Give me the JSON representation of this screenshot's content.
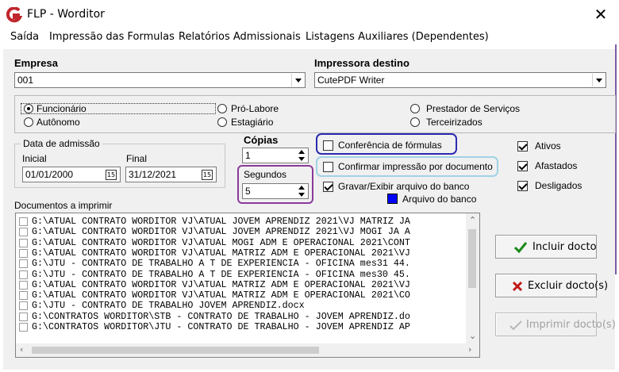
{
  "window": {
    "title": "FLP - Worditor",
    "close_glyph": "✕",
    "logo_color": "#c0272d"
  },
  "menu": [
    "Saída",
    "Impressão das Formulas",
    "Relatórios Admissionais",
    "Listagens Auxiliares (Dependentes)"
  ],
  "empresa": {
    "label": "Empresa",
    "value": "001"
  },
  "impressora": {
    "label": "Impressora destino",
    "value": "CutePDF Writer"
  },
  "tipo": {
    "options": [
      "Funcionário",
      "Pró-Labore",
      "Prestador de Serviços",
      "Autônomo",
      "Estagiário",
      "Terceirizados"
    ],
    "selected": "Funcionário"
  },
  "admissao": {
    "label": "Data de admissão",
    "inicial_label": "Inicial",
    "inicial": "01/01/2000",
    "final_label": "Final",
    "final": "31/12/2021",
    "calendar_glyph": "15"
  },
  "copias": {
    "label": "Cópias",
    "value": "1"
  },
  "segundos": {
    "label": "Segundos",
    "value": "5"
  },
  "options": {
    "conferencia": {
      "label": "Conferência de fórmulas",
      "checked": false,
      "highlight": "#2b2bb0"
    },
    "confirmar": {
      "label": "Confirmar impressão por documento",
      "checked": false,
      "highlight": "#9fd3e6"
    },
    "gravar": {
      "label": "Gravar/Exibir arquivo do banco",
      "checked": true
    },
    "arquivo": {
      "label": "Arquivo do banco",
      "swatch": "#0000ff"
    }
  },
  "segundos_highlight": "#8a3a9a",
  "status": {
    "ativos": "Ativos",
    "afastados": "Afastados",
    "desligados": "Desligados"
  },
  "docs": {
    "label": "Documentos a imprimir",
    "items": [
      "G:\\ATUAL CONTRATO WORDITOR VJ\\ATUAL JOVEM APRENDIZ 2021\\VJ MATRIZ JA",
      "G:\\ATUAL CONTRATO WORDITOR VJ\\ATUAL JOVEM APRENDIZ 2021\\VJ MOGI JA A",
      "G:\\ATUAL CONTRATO WORDITOR VJ\\ATUAL MOGI ADM E OPERACIONAL 2021\\CONT",
      "G:\\ATUAL CONTRATO WORDITOR VJ\\ATUAL MATRIZ ADM E OPERACIONAL 2021\\VJ",
      "G:\\JTU - CONTRATO DE TRABALHO A T DE EXPERIÊNCIA - OFICINA mes31 44.",
      "G:\\JTU - CONTRATO DE TRABALHO A T DE EXPERIÊNCIA - OFICINA mes30 45.",
      "G:\\ATUAL CONTRATO WORDITOR VJ\\ATUAL MATRIZ ADM E OPERACIONAL 2021\\VJ",
      "G:\\ATUAL CONTRATO WORDITOR VJ\\ATUAL MATRIZ ADM E OPERACIONAL 2021\\CO",
      "G:\\JTU - CONTRATO DE TRABALHO JOVEM APRENDIZ.docx",
      "G:\\CONTRATOS WORDITOR\\STB - CONTRATO DE TRABALHO - JOVEM APRENDIZ.do",
      "G:\\CONTRATOS WORDITOR\\JTU - CONTRATO DE TRABALHO - JOVEM APRENDIZ AP"
    ]
  },
  "buttons": {
    "incluir": "Incluir docto",
    "excluir": "Excluir docto(s)",
    "imprimir": "Imprimir docto(s)"
  }
}
